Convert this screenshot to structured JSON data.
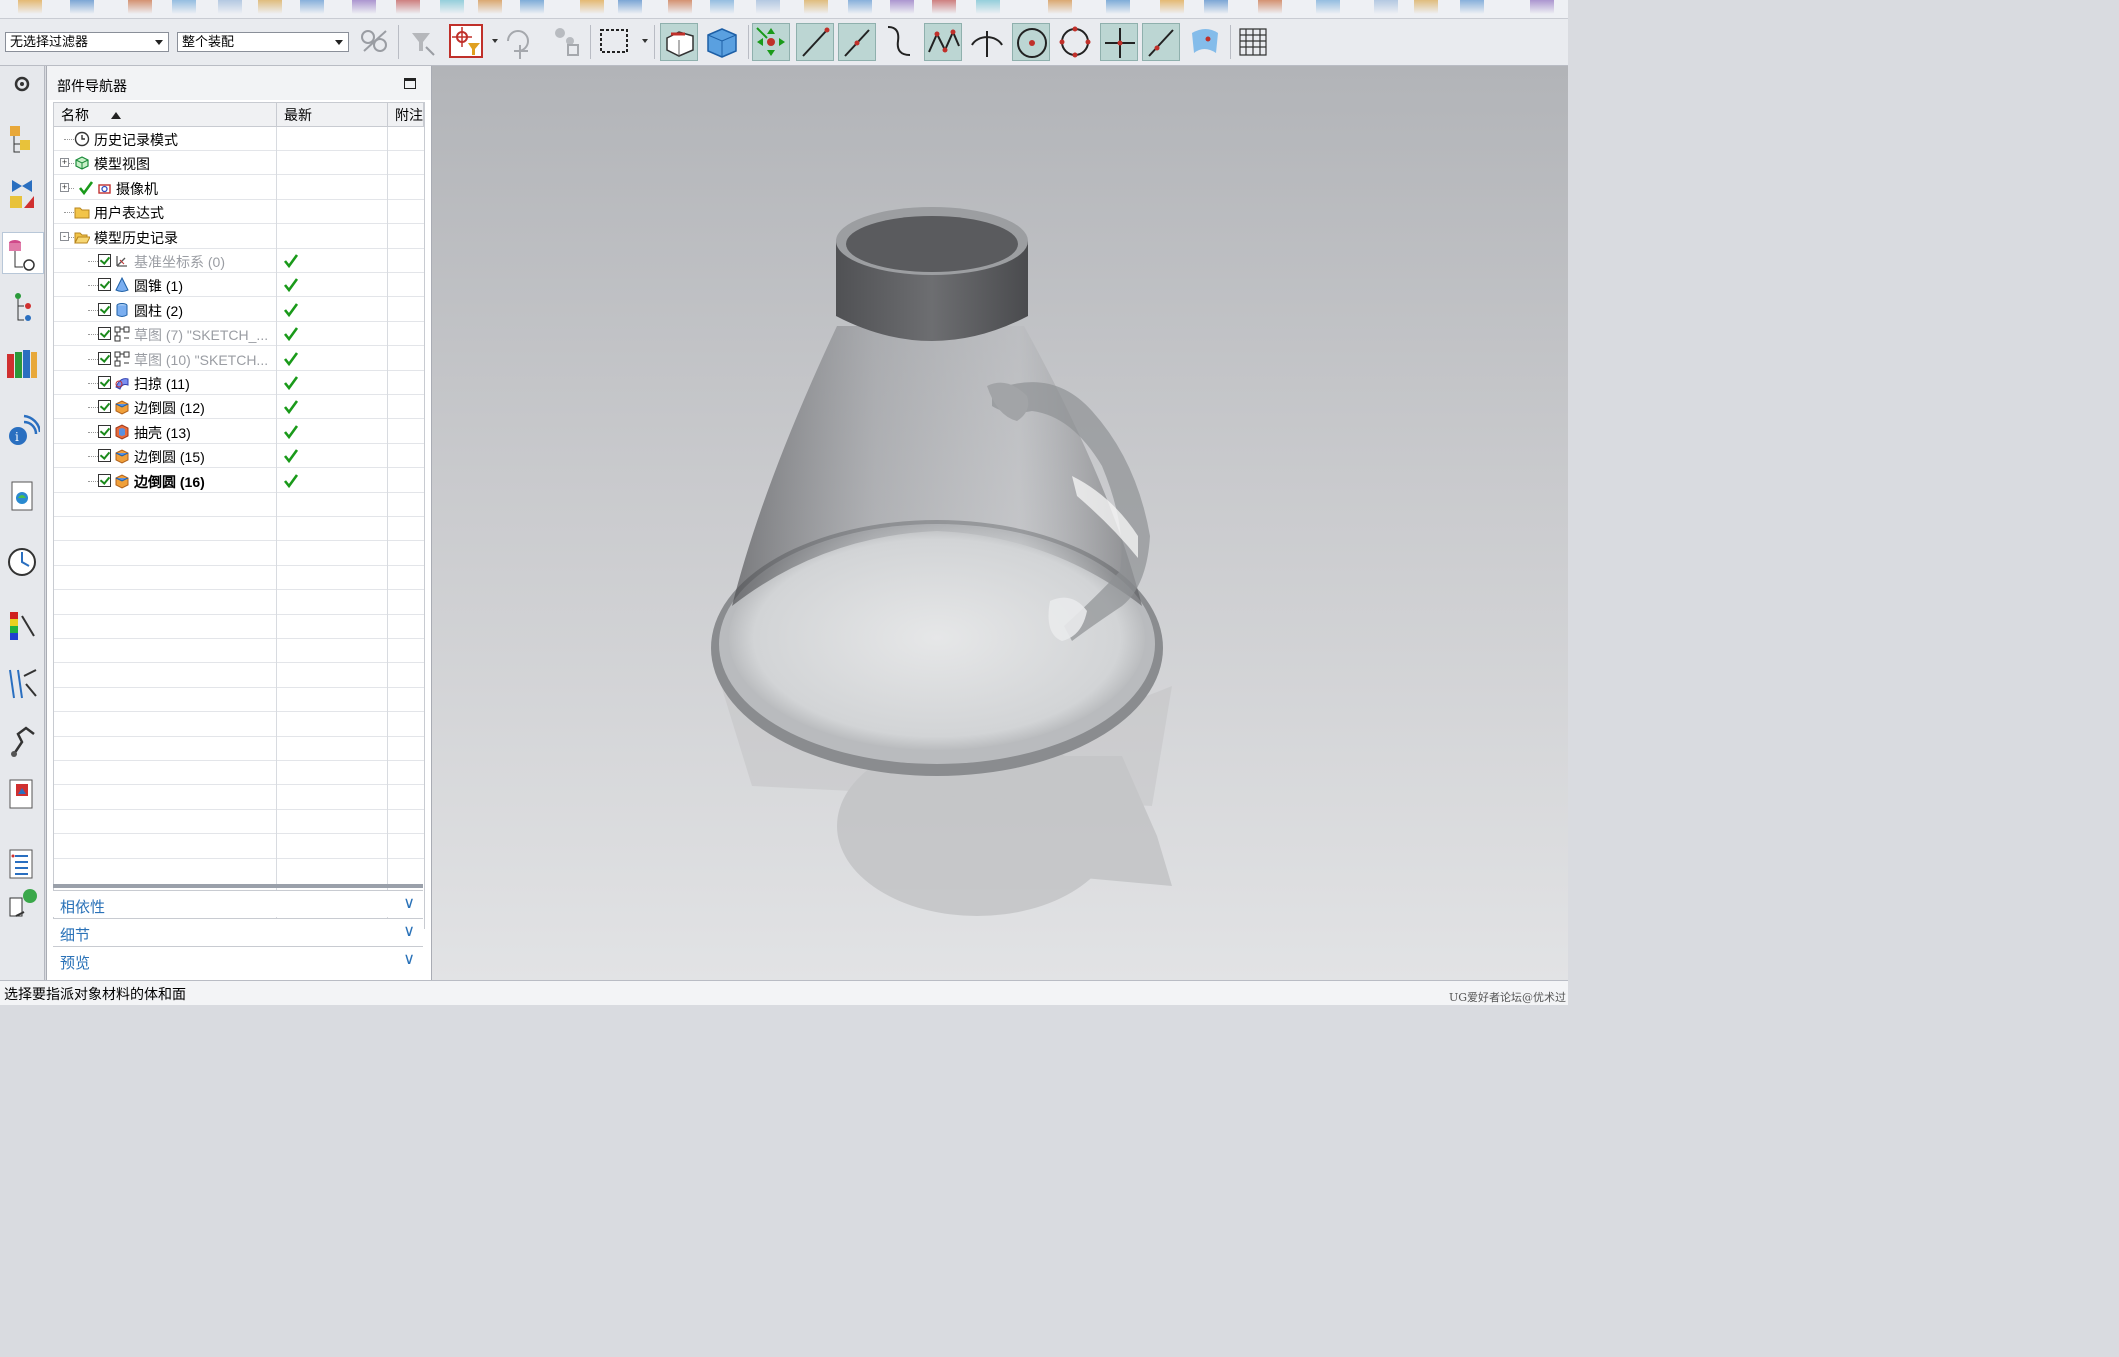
{
  "toolbar": {
    "filter_value": "无选择过滤器",
    "scope_value": "整个装配"
  },
  "navigator": {
    "title": "部件导航器",
    "columns": [
      "名称",
      "最新",
      "附注"
    ],
    "sort_indicator": "ascending",
    "rows": [
      {
        "label": "历史记录模式",
        "icon": "history-clock-icon",
        "level": 0,
        "expander": "",
        "checkbox": false,
        "style": "normal",
        "latest": false
      },
      {
        "label": "模型视图",
        "icon": "model-views-icon",
        "level": 0,
        "expander": "+",
        "checkbox": false,
        "style": "normal",
        "latest": false
      },
      {
        "label": "摄像机",
        "icon": "camera-icon",
        "level": 0,
        "expander": "+",
        "checkbox": false,
        "check_mark": true,
        "style": "normal",
        "latest": false
      },
      {
        "label": "用户表达式",
        "icon": "folder-icon",
        "level": 0,
        "expander": "",
        "checkbox": false,
        "style": "normal",
        "latest": false
      },
      {
        "label": "模型历史记录",
        "icon": "open-folder-icon",
        "level": 0,
        "expander": "-",
        "checkbox": false,
        "style": "normal",
        "latest": false
      },
      {
        "label": "基准坐标系 (0)",
        "icon": "datum-csys-icon",
        "level": 1,
        "expander": "",
        "checkbox": true,
        "style": "dim",
        "latest": true
      },
      {
        "label": "圆锥 (1)",
        "icon": "cone-icon",
        "level": 1,
        "expander": "",
        "checkbox": true,
        "style": "normal",
        "latest": true
      },
      {
        "label": "圆柱 (2)",
        "icon": "cylinder-icon",
        "level": 1,
        "expander": "",
        "checkbox": true,
        "style": "normal",
        "latest": true
      },
      {
        "label": "草图 (7) \"SKETCH_...",
        "icon": "sketch-icon",
        "level": 1,
        "expander": "",
        "checkbox": true,
        "style": "dim",
        "latest": true
      },
      {
        "label": "草图 (10) \"SKETCH...",
        "icon": "sketch-icon",
        "level": 1,
        "expander": "",
        "checkbox": true,
        "style": "dim",
        "latest": true
      },
      {
        "label": "扫掠 (11)",
        "icon": "swept-icon",
        "level": 1,
        "expander": "",
        "checkbox": true,
        "style": "normal",
        "latest": true
      },
      {
        "label": "边倒圆 (12)",
        "icon": "edge-blend-icon",
        "level": 1,
        "expander": "",
        "checkbox": true,
        "style": "normal",
        "latest": true
      },
      {
        "label": "抽壳 (13)",
        "icon": "shell-icon",
        "level": 1,
        "expander": "",
        "checkbox": true,
        "style": "normal",
        "latest": true
      },
      {
        "label": "边倒圆 (15)",
        "icon": "edge-blend-icon",
        "level": 1,
        "expander": "",
        "checkbox": true,
        "style": "normal",
        "latest": true
      },
      {
        "label": "边倒圆 (16)",
        "icon": "edge-blend-icon",
        "level": 1,
        "expander": "",
        "checkbox": true,
        "style": "bold",
        "latest": true
      }
    ],
    "panels": [
      {
        "label": "相依性",
        "icon": "chevron-down-icon"
      },
      {
        "label": "细节",
        "icon": "chevron-down-icon"
      },
      {
        "label": "预览",
        "icon": "chevron-down-icon"
      }
    ]
  },
  "resource_bar": [
    "settings-gear-icon",
    "assembly-navigator-icon",
    "constraint-navigator-icon",
    "part-navigator-icon",
    "reuse-library-icon",
    "hd3d-tools-icon",
    "web-browser-icon",
    "history-icon",
    "visualization-icon",
    "process-studio-icon",
    "machine-tool-icon",
    "manufacturing-wizard-icon",
    "roles-icon",
    "system-materials-icon"
  ],
  "status": {
    "message": "选择要指派对象材料的体和面",
    "watermark": "UG爱好者论坛@优术过"
  },
  "colors": {
    "accent_blue": "#2a72b8",
    "check_green": "#1a9a1a",
    "toggle_active": "#bcd6d3"
  }
}
